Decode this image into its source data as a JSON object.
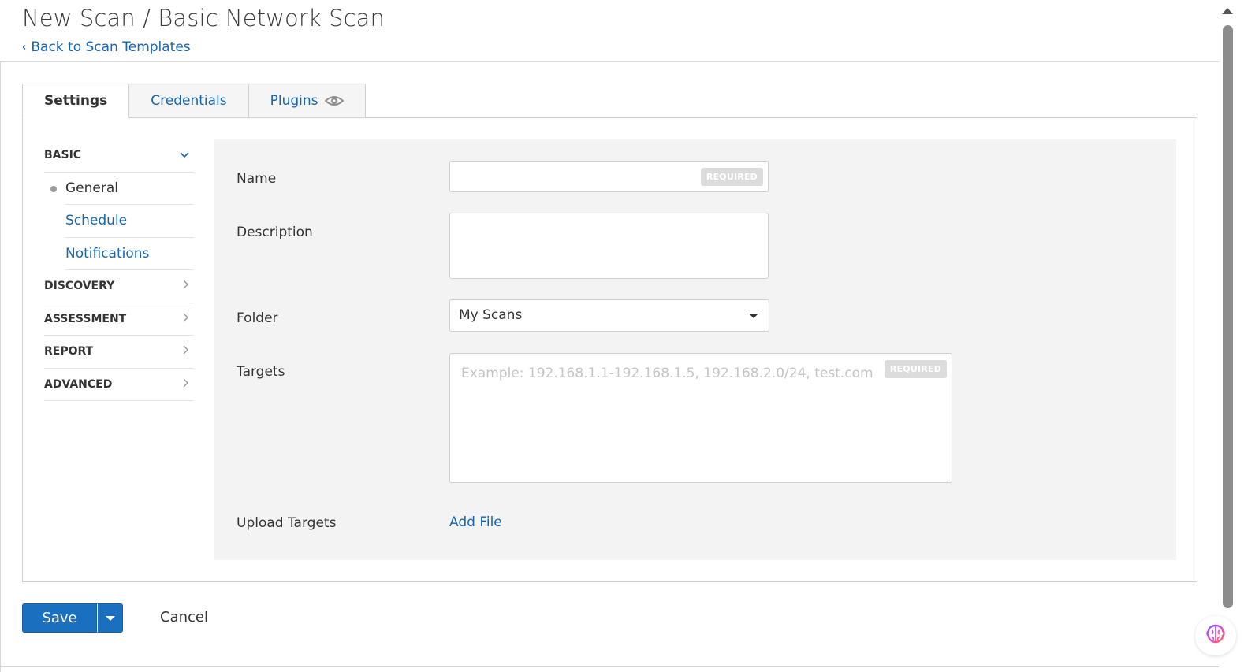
{
  "header": {
    "title": "New Scan / Basic Network Scan",
    "back_label": "Back to Scan Templates"
  },
  "tabs": [
    {
      "label": "Settings",
      "active": true
    },
    {
      "label": "Credentials",
      "active": false
    },
    {
      "label": "Plugins",
      "active": false,
      "icon": "eye-icon"
    }
  ],
  "sidebar": {
    "sections": [
      {
        "label": "BASIC",
        "expanded": true,
        "items": [
          {
            "label": "General",
            "current": true
          },
          {
            "label": "Schedule",
            "current": false
          },
          {
            "label": "Notifications",
            "current": false
          }
        ]
      },
      {
        "label": "DISCOVERY",
        "expanded": false
      },
      {
        "label": "ASSESSMENT",
        "expanded": false
      },
      {
        "label": "REPORT",
        "expanded": false
      },
      {
        "label": "ADVANCED",
        "expanded": false
      }
    ]
  },
  "form": {
    "name": {
      "label": "Name",
      "value": "",
      "badge": "REQUIRED"
    },
    "description": {
      "label": "Description",
      "value": ""
    },
    "folder": {
      "label": "Folder",
      "value": "My Scans"
    },
    "targets": {
      "label": "Targets",
      "placeholder": "Example: 192.168.1.1-192.168.1.5, 192.168.2.0/24, test.com",
      "badge": "REQUIRED"
    },
    "upload": {
      "label": "Upload Targets",
      "link": "Add File"
    }
  },
  "actions": {
    "save": "Save",
    "cancel": "Cancel"
  },
  "colors": {
    "link": "#1565b3",
    "primary": "#1a6fbf",
    "panel": "#f3f3f3"
  }
}
